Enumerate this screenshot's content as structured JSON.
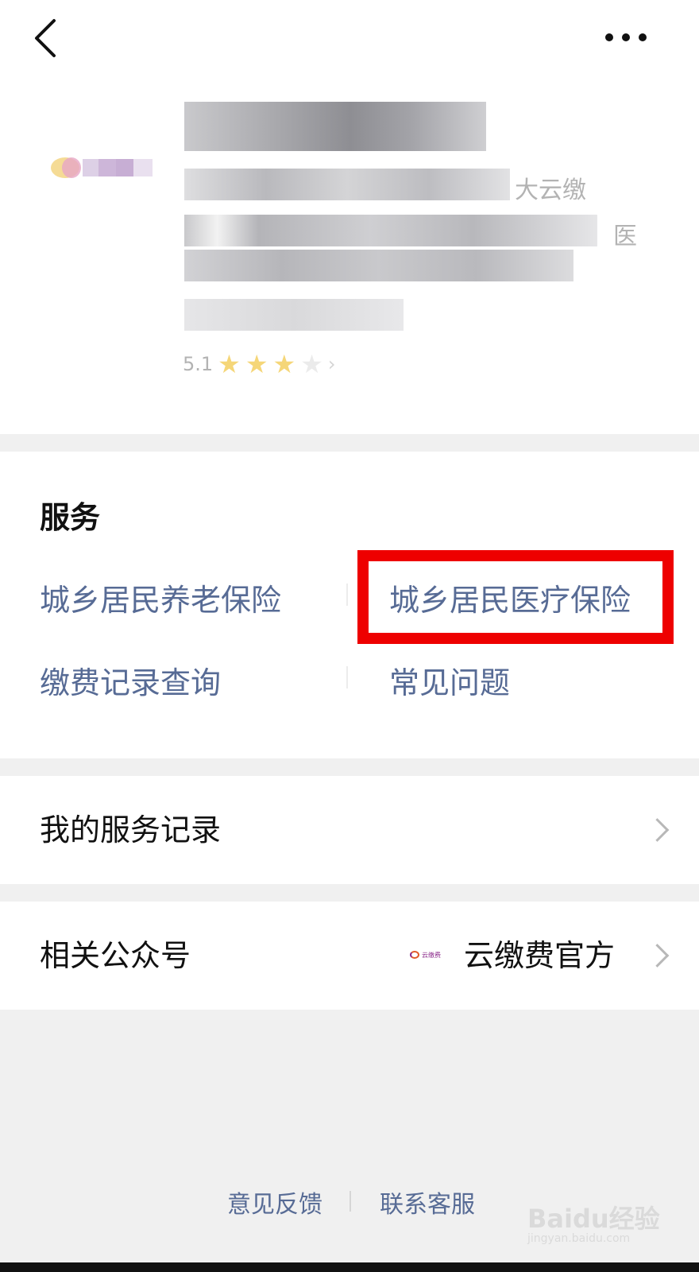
{
  "header": {
    "back_icon": "chevron-left-icon",
    "more_icon": "more-horizontal-icon"
  },
  "profile": {
    "partial_text_1": "大云缴",
    "partial_text_2": "医",
    "rating_value": "5.1"
  },
  "services": {
    "title": "服务",
    "items": [
      {
        "label": "城乡居民养老保险"
      },
      {
        "label": "城乡居民医疗保险",
        "highlighted": true
      },
      {
        "label": "缴费记录查询"
      },
      {
        "label": "常见问题"
      }
    ],
    "highlight_color": "#ee0000",
    "link_color": "#576b95"
  },
  "service_record": {
    "label": "我的服务记录"
  },
  "related_account": {
    "label": "相关公众号",
    "value": "云缴费官方",
    "logo_text": "云缴费"
  },
  "footer": {
    "feedback": "意见反馈",
    "contact": "联系客服"
  },
  "watermark": {
    "main": "Baidu经验",
    "sub": "jingyan.baidu.com"
  }
}
